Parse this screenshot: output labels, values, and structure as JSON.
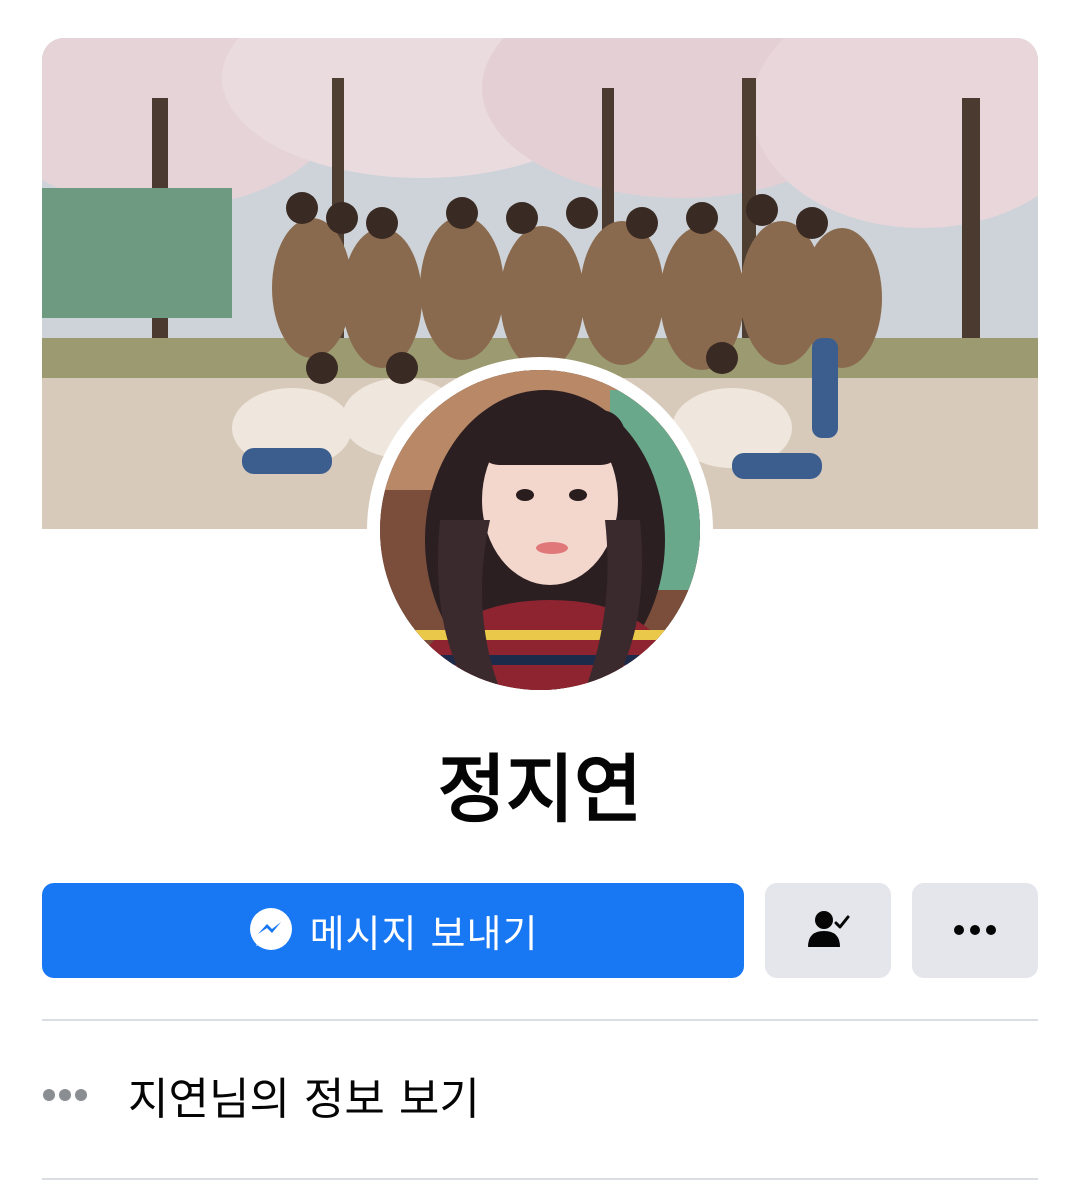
{
  "profile": {
    "name": "정지연",
    "cover_photo": "group-photo-under-cherry-blossoms",
    "avatar_photo": "selfie-portrait"
  },
  "actions": {
    "message_label": "메시지 보내기",
    "message_icon": "messenger-icon",
    "friend_icon": "friend-check-icon",
    "more_icon": "more-dots-icon"
  },
  "info": {
    "label": "지연님의 정보 보기",
    "icon": "more-dots-icon"
  },
  "colors": {
    "primary": "#1877f2",
    "secondary_button": "#e4e6eb",
    "text": "#050505",
    "divider": "#dadde1",
    "muted_icon": "#8a8d91"
  }
}
